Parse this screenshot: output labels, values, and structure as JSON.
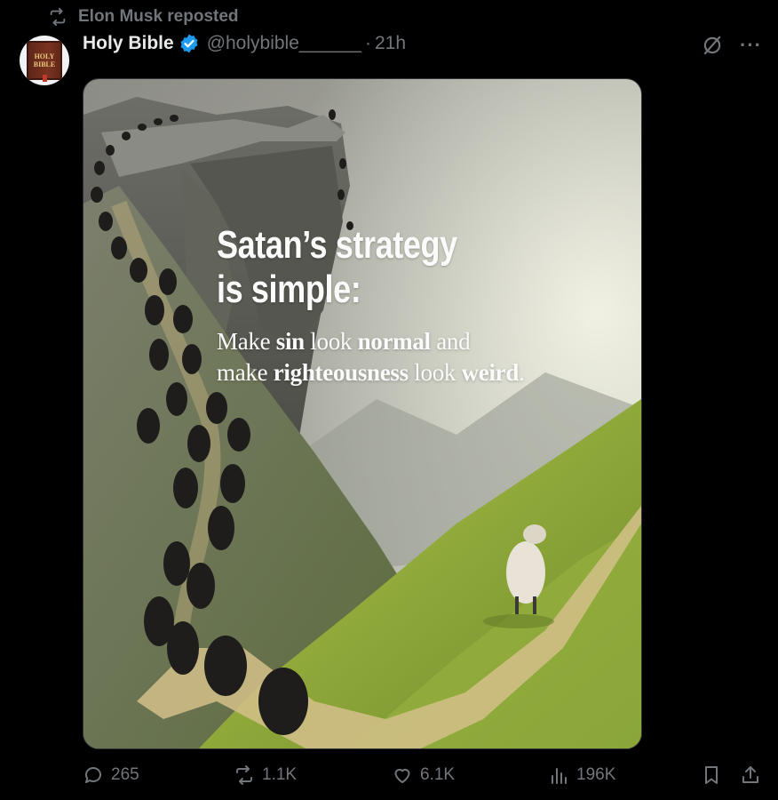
{
  "repost": {
    "text": "Elon Musk reposted",
    "icon": "repost-icon"
  },
  "post": {
    "author": {
      "name": "Holy Bible",
      "handle": "@holybible______",
      "verified": true,
      "avatar_text": [
        "HOLY",
        "BIBLE"
      ]
    },
    "separator": "·",
    "time": "21h",
    "image": {
      "title_line1": "Satan’s strategy",
      "title_line2": "is simple:",
      "body": {
        "l1_a": "Make ",
        "l1_b": "sin",
        "l1_c": " look ",
        "l1_d": "normal",
        "l1_e": " and",
        "l2_a": "make ",
        "l2_b": "righteousness",
        "l2_c": " look ",
        "l2_d": "weird",
        "l2_e": "."
      }
    },
    "actions": {
      "replies": "265",
      "reposts": "1.1K",
      "likes": "6.1K",
      "views": "196K"
    }
  },
  "colors": {
    "verified": "#1d9bf0",
    "muted": "#71767b",
    "text": "#e7e9ea",
    "background": "#000000"
  }
}
